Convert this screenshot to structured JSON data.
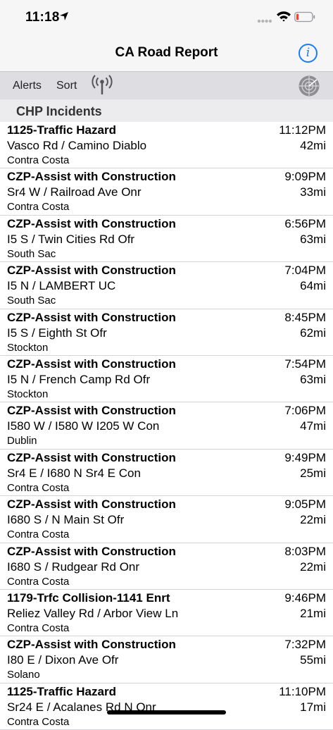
{
  "status": {
    "time": "11:18"
  },
  "nav": {
    "title": "CA Road Report",
    "info_icon": "i"
  },
  "toolbar": {
    "alerts_label": "Alerts",
    "sort_label": "Sort"
  },
  "section": {
    "title": "CHP Incidents"
  },
  "incidents": [
    {
      "title": "1125-Traffic Hazard",
      "location": "Vasco Rd / Camino Diablo",
      "area": "Contra Costa",
      "time": "11:12PM",
      "distance": "42mi"
    },
    {
      "title": "CZP-Assist with Construction",
      "location": "Sr4 W / Railroad Ave Onr",
      "area": "Contra Costa",
      "time": "9:09PM",
      "distance": "33mi"
    },
    {
      "title": "CZP-Assist with Construction",
      "location": "I5 S / Twin Cities Rd Ofr",
      "area": "South Sac",
      "time": "6:56PM",
      "distance": "63mi"
    },
    {
      "title": "CZP-Assist with Construction",
      "location": "I5 N / LAMBERT UC",
      "area": "South Sac",
      "time": "7:04PM",
      "distance": "64mi"
    },
    {
      "title": "CZP-Assist with Construction",
      "location": "I5 S / Eighth St Ofr",
      "area": "Stockton",
      "time": "8:45PM",
      "distance": "62mi"
    },
    {
      "title": "CZP-Assist with Construction",
      "location": "I5 N / French Camp Rd Ofr",
      "area": "Stockton",
      "time": "7:54PM",
      "distance": "63mi"
    },
    {
      "title": "CZP-Assist with Construction",
      "location": "I580 W / I580 W I205  W Con",
      "area": "Dublin",
      "time": "7:06PM",
      "distance": "47mi"
    },
    {
      "title": "CZP-Assist with Construction",
      "location": "Sr4 E / I680 N Sr4 E Con",
      "area": "Contra Costa",
      "time": "9:49PM",
      "distance": "25mi"
    },
    {
      "title": "CZP-Assist with Construction",
      "location": "I680 S / N Main St Ofr",
      "area": "Contra Costa",
      "time": "9:05PM",
      "distance": "22mi"
    },
    {
      "title": "CZP-Assist with Construction",
      "location": "I680 S / Rudgear Rd Onr",
      "area": "Contra Costa",
      "time": "8:03PM",
      "distance": "22mi"
    },
    {
      "title": "1179-Trfc Collision-1141 Enrt",
      "location": "Reliez Valley Rd / Arbor View Ln",
      "area": "Contra Costa",
      "time": "9:46PM",
      "distance": "21mi"
    },
    {
      "title": "CZP-Assist with Construction",
      "location": "I80 E / Dixon Ave Ofr",
      "area": "Solano",
      "time": "7:32PM",
      "distance": "55mi"
    },
    {
      "title": "1125-Traffic Hazard",
      "location": "Sr24 E / Acalanes Rd N Onr",
      "area": "Contra Costa",
      "time": "11:10PM",
      "distance": "17mi"
    }
  ]
}
